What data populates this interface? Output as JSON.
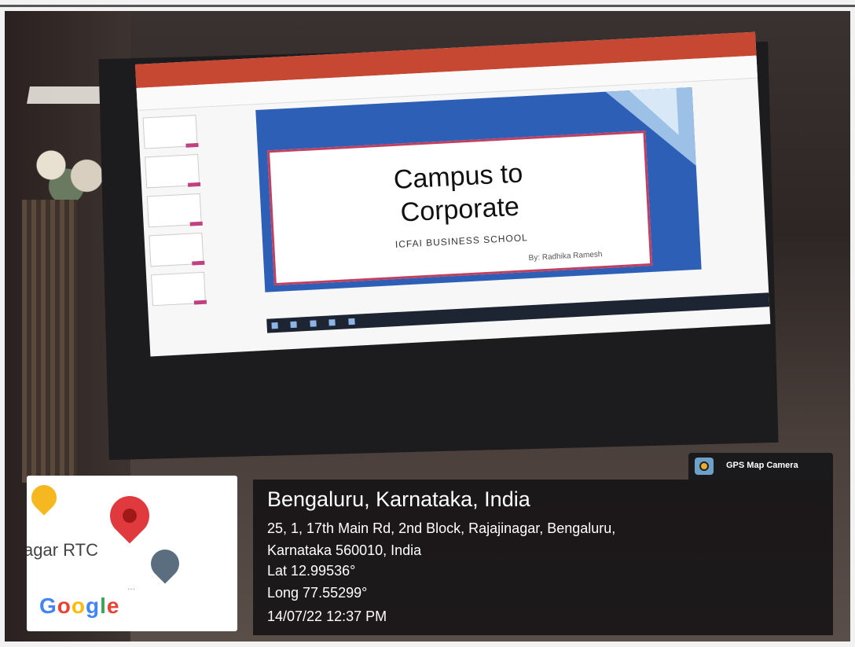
{
  "slide": {
    "title_line1": "Campus to",
    "title_line2": "Corporate",
    "subtitle": "ICFAI BUSINESS SCHOOL",
    "byline": "By: Radhika Ramesh"
  },
  "gps_badge": {
    "label": "GPS Map Camera"
  },
  "location": {
    "city": "Bengaluru, Karnataka, India",
    "address_line1": "25, 1, 17th Main Rd, 2nd Block, Rajajinagar, Bengaluru,",
    "address_line2": "Karnataka 560010, India",
    "lat": "Lat 12.99536°",
    "long": "Long 77.55299°",
    "datetime": "14/07/22 12:37 PM"
  },
  "map": {
    "place_label": "agar RTC",
    "provider_logo": "Google",
    "logo_colors": [
      "#4285F4",
      "#EA4335",
      "#FBBC05",
      "#4285F4",
      "#34A853",
      "#EA4335"
    ]
  },
  "icons": [
    "map-pin-red-icon",
    "map-pin-yellow-icon",
    "map-pin-gray-icon",
    "gps-camera-logo-icon"
  ]
}
